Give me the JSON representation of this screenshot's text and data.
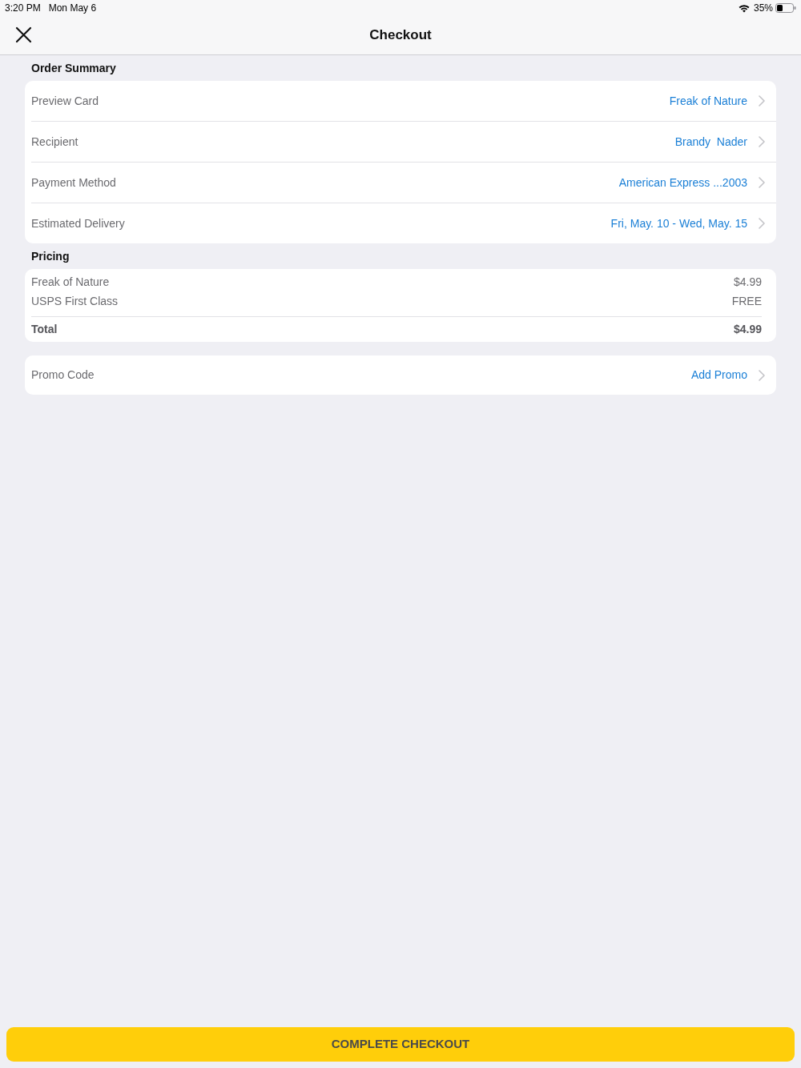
{
  "status_bar": {
    "time": "3:20 PM",
    "date": "Mon May 6",
    "battery_percent": "35%"
  },
  "nav_bar": {
    "title": "Checkout"
  },
  "order_summary": {
    "heading": "Order Summary",
    "rows": [
      {
        "label": "Preview Card",
        "value": "Freak of Nature"
      },
      {
        "label": "Recipient",
        "value": "Brandy  Nader"
      },
      {
        "label": "Payment Method",
        "value": "American Express ...2003"
      },
      {
        "label": "Estimated Delivery",
        "value": "Fri, May. 10 - Wed, May. 15"
      }
    ]
  },
  "pricing": {
    "heading": "Pricing",
    "items": [
      {
        "label": "Freak of Nature",
        "amount": "$4.99"
      },
      {
        "label": "USPS First Class",
        "amount": "FREE"
      }
    ],
    "total": {
      "label": "Total",
      "amount": "$4.99"
    }
  },
  "promo": {
    "label": "Promo Code",
    "value": "Add Promo"
  },
  "checkout_button": {
    "label": "COMPLETE CHECKOUT"
  }
}
